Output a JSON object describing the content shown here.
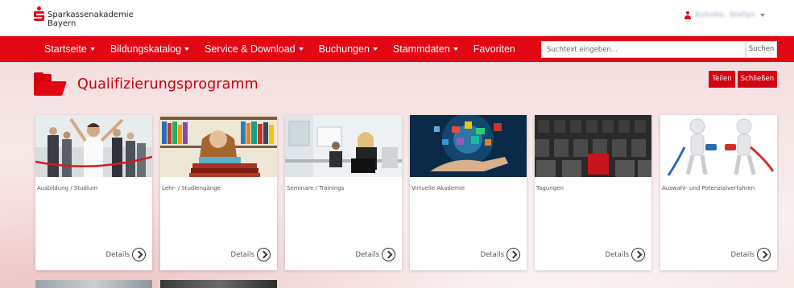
{
  "header": {
    "brand_line1": "Sparkassenakademie",
    "brand_line2": "Bayern",
    "user_name": "Kuhnke, Stefan"
  },
  "nav": {
    "items": [
      {
        "label": "Startseite",
        "dropdown": true
      },
      {
        "label": "Bildungskatalog",
        "dropdown": true
      },
      {
        "label": "Service & Download",
        "dropdown": true
      },
      {
        "label": "Buchungen",
        "dropdown": true
      },
      {
        "label": "Stammdaten",
        "dropdown": true
      },
      {
        "label": "Favoriten",
        "dropdown": false
      }
    ],
    "search_placeholder": "Suchtext eingeben...",
    "search_button": "Suchen"
  },
  "page": {
    "title": "Qualifizierungsprogramm",
    "share_button": "Teilen",
    "close_button": "Schließen"
  },
  "cards": [
    {
      "label": "Ausbildung / Studium",
      "details": "Details",
      "image": "graduates-celebrating"
    },
    {
      "label": "Lehr- / Studiengänge",
      "details": "Details",
      "image": "student-with-books"
    },
    {
      "label": "Seminare / Trainings",
      "details": "Details",
      "image": "seminar-room"
    },
    {
      "label": "Virtuelle Akademie",
      "details": "Details",
      "image": "digital-hand"
    },
    {
      "label": "Tagungen",
      "details": "Details",
      "image": "conference-chairs"
    },
    {
      "label": "Auswahl- und Potenzialverfahren",
      "details": "Details",
      "image": "connecting-figures"
    }
  ],
  "colors": {
    "brand_red": "#e30613",
    "title_red": "#c8000f",
    "button_red": "#d40412"
  }
}
